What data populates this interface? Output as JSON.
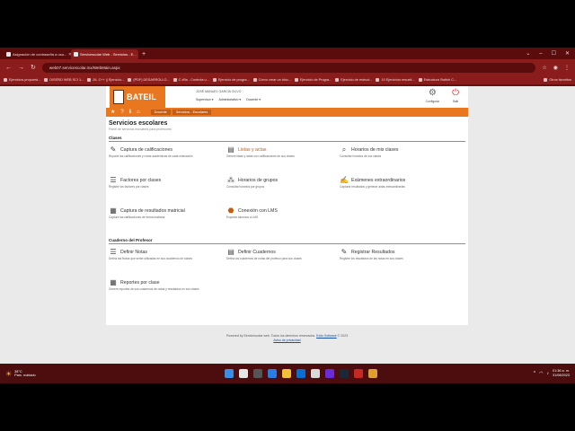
{
  "browser": {
    "tabs": [
      {
        "label": "Asignación de contraseña a usu..."
      },
      {
        "label": "Servicescolar Web - Servicios - E..."
      }
    ],
    "new_tab": "+",
    "url": "web07.servicescolar.mx/WebMain.aspx",
    "window_controls": [
      "⌄",
      "–",
      "☐",
      "✕"
    ],
    "bookmarks": [
      {
        "label": "Ejercicios propuest..."
      },
      {
        "label": "DISEÑO WEB SCI 1..."
      },
      {
        "label": "26. C++ || Ejercicio..."
      },
      {
        "label": "(PDF) DESARROLLO..."
      },
      {
        "label": "C #9a - Controla u..."
      },
      {
        "label": "Ejercicio de progra..."
      },
      {
        "label": "Cómo crear un bloc..."
      },
      {
        "label": "Ejercicio de Progra..."
      },
      {
        "label": "Ejercicio de estruct..."
      },
      {
        "label": "10 Ejercicios resuelt..."
      },
      {
        "label": "Estructura Switch C..."
      }
    ],
    "other_favorites": "Otros favoritos"
  },
  "header": {
    "logo_text": "BATEIL",
    "user_name": "JOSÉ MANUEL GARCÍA OLIVO",
    "menus": [
      "Supervisor ▾",
      "Administrativo ▾",
      "Docente ▾"
    ],
    "configurar": "Configurar",
    "salir": "Salir"
  },
  "nav": {
    "breadcrumb": [
      "Docente",
      "Servicios - Escolares"
    ]
  },
  "main": {
    "title": "Servicios escolares",
    "subtitle": "Panel de servicios escolares para profesores",
    "sections": [
      {
        "label": "Clases",
        "items": [
          {
            "title": "Captura de calificaciones",
            "desc": "Reporte las calificaciones y notas académicas de cada evaluación"
          },
          {
            "title": "Listas y actas",
            "desc": "Genere listas y actas con calificaciones de sus clases"
          },
          {
            "title": "Horarios de mis clases",
            "desc": "Consultar horarios de sus clases"
          },
          {
            "title": "Factores por clases",
            "desc": "Registre los factores por clases"
          },
          {
            "title": "Horarios de grupos",
            "desc": "Consultar horarios por grupos"
          },
          {
            "title": "Exámenes extraordinarios",
            "desc": "Capturar resultados y generar actas extraordinarias"
          },
          {
            "title": "Captura de resultados matricial",
            "desc": "Capture las calificaciones de forma matricial"
          },
          {
            "title": "Conexión con LMS",
            "desc": "Exportar alumnos a LMS"
          }
        ]
      },
      {
        "label": "Cuaderno del Profesor",
        "items": [
          {
            "title": "Definir Notas",
            "desc": "Defina las Notas que serán utilizadas en sus cuadernos de clases"
          },
          {
            "title": "Definir Cuadernos",
            "desc": "Defina los cuadernos de notas del profesor para sus clases"
          },
          {
            "title": "Registrar Resultados",
            "desc": "Registre los resultados de las notas en sus clases"
          },
          {
            "title": "Reportes por clase",
            "desc": "Genere reportes de sus cuadernos de notas y resultados en sus clases"
          }
        ]
      }
    ]
  },
  "footer": {
    "text": "Powered by Servicescolar web. Todos los derechos reservados.",
    "company": "Exito Software",
    "year": "© 2023",
    "privacy": "Aviso de privacidad"
  },
  "taskbar": {
    "temp": "38°C",
    "weather": "Parc. nublado",
    "time": "01:36 a. m.",
    "date": "31/08/2023"
  },
  "colors": {
    "brand": "#e8771f",
    "browser": "#8a1c1c",
    "active_link": "#c35d13"
  }
}
